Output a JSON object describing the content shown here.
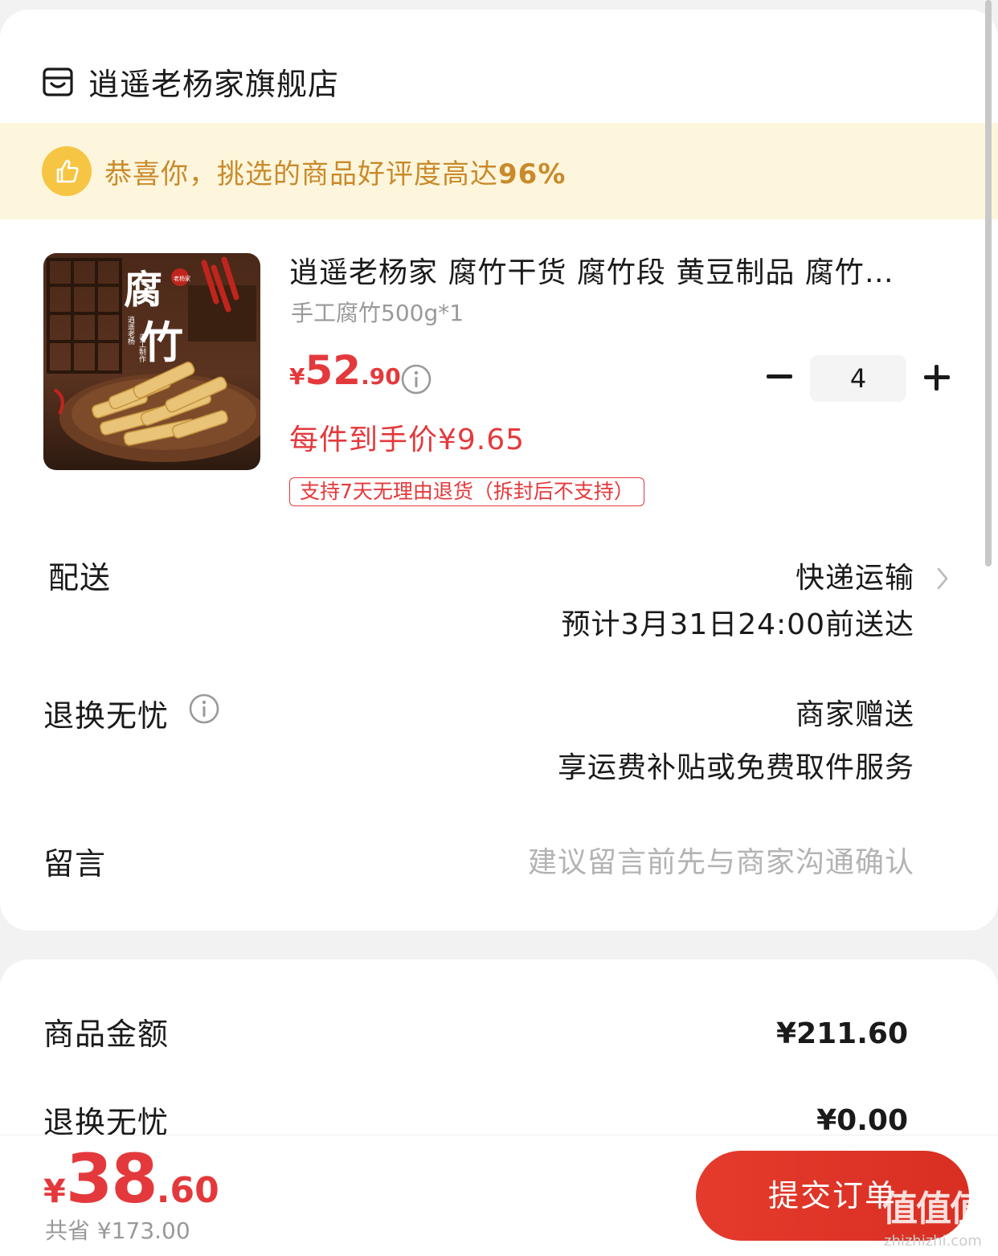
{
  "store": {
    "name": "逍遥老杨家旗舰店"
  },
  "banner": {
    "text": "恭喜你，挑选的商品好评度高达",
    "percent": "96%"
  },
  "product": {
    "title": "逍遥老杨家 腐竹干货 腐竹段 黄豆制品 腐竹…",
    "spec": "手工腐竹500g*1",
    "price_currency": "¥",
    "price_int": "52",
    "price_dec": ".90",
    "unit_price": "每件到手价¥9.65",
    "return_tag": "支持7天无理由退货（拆封后不支持）",
    "quantity": "4",
    "image_text": {
      "big1": "腐",
      "big2": "竹",
      "seal": "老杨家",
      "side": "逍遥老杨",
      "side2": "手工制作"
    }
  },
  "delivery": {
    "label": "配送",
    "method": "快递运输",
    "eta": "预计3月31日24:00前送达"
  },
  "returns": {
    "label": "退换无忧",
    "value": "商家赠送",
    "detail": "享运费补贴或免费取件服务"
  },
  "message": {
    "label": "留言",
    "placeholder": "建议留言前先与商家沟通确认"
  },
  "summary": {
    "goods_label": "商品金额",
    "goods_value": "¥211.60",
    "returns_label": "退换无忧",
    "returns_value": "¥0.00"
  },
  "footer": {
    "total_currency": "¥",
    "total_int": "38",
    "total_dec": ".60",
    "saved": "共省 ¥173.00",
    "submit": "提交订单"
  },
  "watermark": {
    "main": "值值值",
    "sub": "zhizhizhi.com"
  },
  "colors": {
    "accent": "#e4393c",
    "banner_bg": "#fdf6dc",
    "banner_text": "#c98a2c",
    "badge": "#f7c544"
  }
}
